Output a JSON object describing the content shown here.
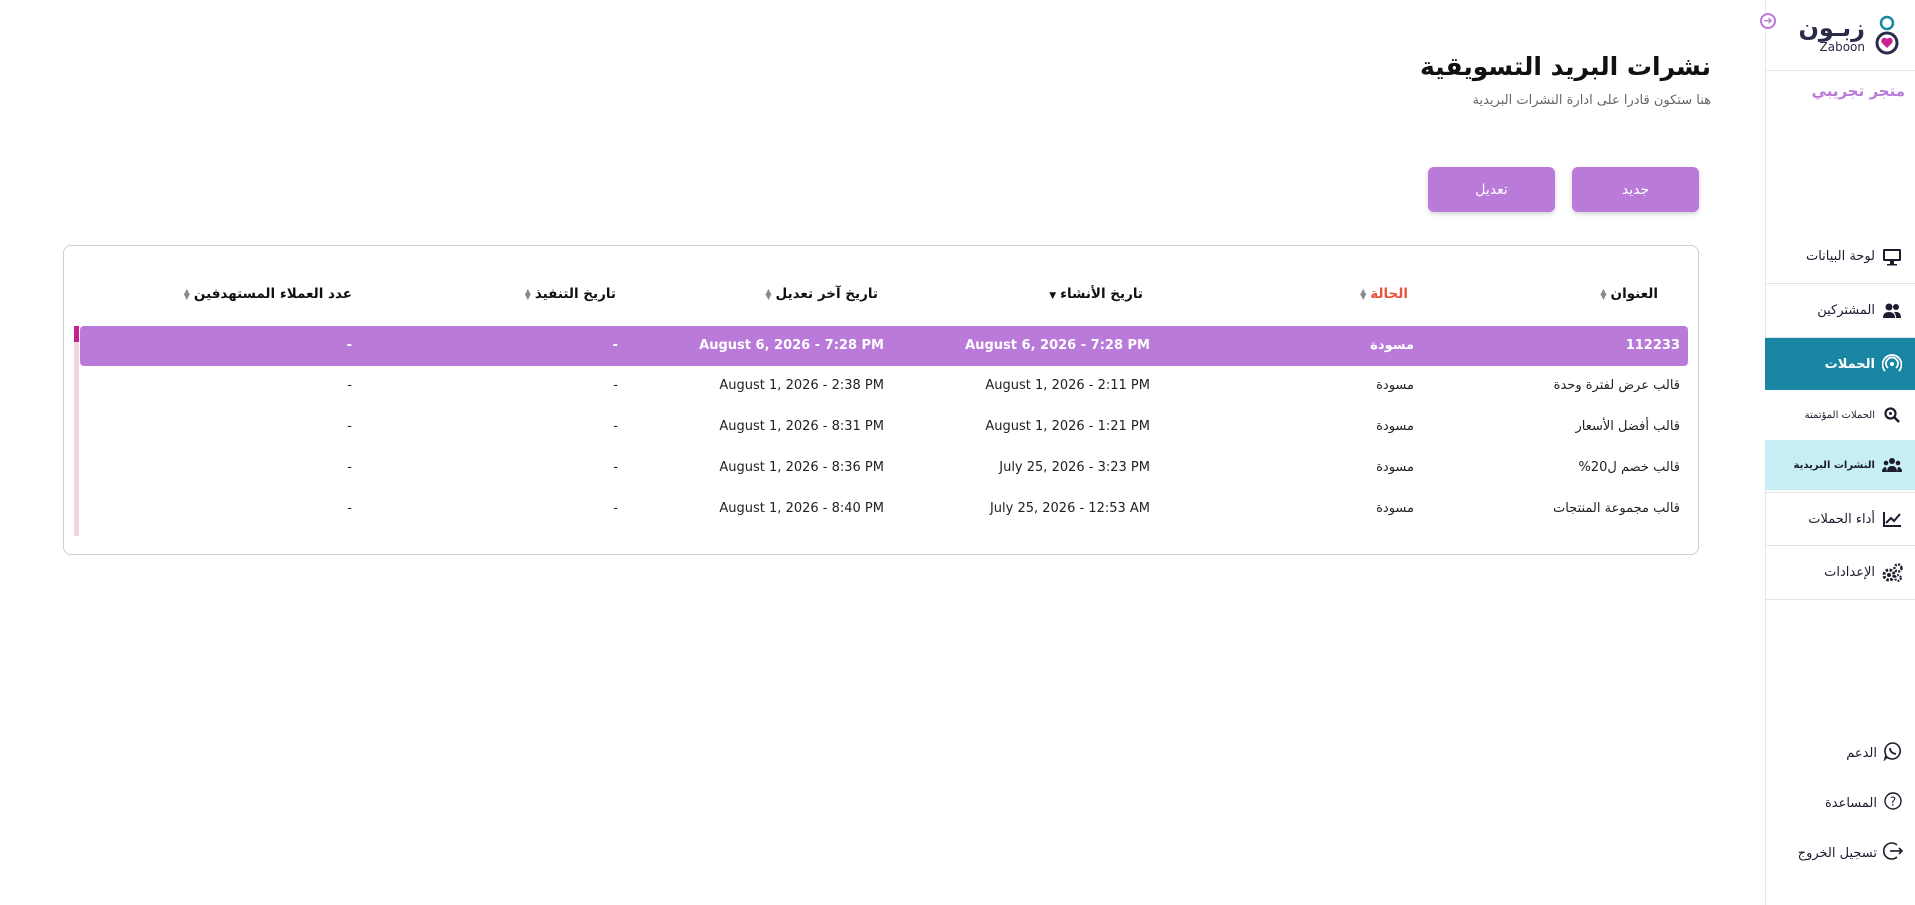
{
  "sidebar": {
    "logo_ar": "زبـون",
    "logo_en": "Zaboon",
    "store_name": "متجر تجريبي",
    "items": [
      {
        "label": "لوحة البيانات"
      },
      {
        "label": "المشتركين"
      },
      {
        "label": "الحملات"
      },
      {
        "label": "الحملات المؤتمتة"
      },
      {
        "label": "النشرات البريدية"
      },
      {
        "label": "أداء الحملات"
      },
      {
        "label": "الإعدادات"
      }
    ],
    "bottom": [
      {
        "label": "الدعم"
      },
      {
        "label": "المساعدة"
      },
      {
        "label": "تسجيل الخروج"
      }
    ]
  },
  "page": {
    "title": "نشرات البريد التسويقية",
    "subtitle": "هنا ستكون قادرا على ادارة النشرات البريدية"
  },
  "buttons": {
    "new": "جديد",
    "edit": "تعديل"
  },
  "table": {
    "headers": [
      "العنوان",
      "الحالة",
      "تاريخ الأنشاء",
      "تاريخ آخر تعديل",
      "تاريخ التنفيذ",
      "عدد العملاء المستهدفين"
    ],
    "rows": [
      [
        "112233",
        "مسودة",
        "August 6, 2026 - 7:28 PM",
        "August 6, 2026 - 7:28 PM",
        "-",
        "-"
      ],
      [
        "قالب عرض لفترة وحدة",
        "مسودة",
        "August 1, 2026 - 2:11 PM",
        "August 1, 2026 - 2:38 PM",
        "-",
        "-"
      ],
      [
        "قالب أفضل الأسعار",
        "مسودة",
        "August 1, 2026 - 1:21 PM",
        "August 1, 2026 - 8:31 PM",
        "-",
        "-"
      ],
      [
        "قالب خصم ل20%",
        "مسودة",
        "July 25, 2026 - 3:23 PM",
        "August 1, 2026 - 8:36 PM",
        "-",
        "-"
      ],
      [
        "قالب مجموعة المنتجات",
        "مسودة",
        "July 25, 2026 - 12:53 AM",
        "August 1, 2026 - 8:40 PM",
        "-",
        "-"
      ]
    ]
  },
  "colors": {
    "accent": "#b97ad9",
    "nav_active": "#1a86a3",
    "sub_active": "#c7eef5",
    "status_header": "#e8523f"
  }
}
